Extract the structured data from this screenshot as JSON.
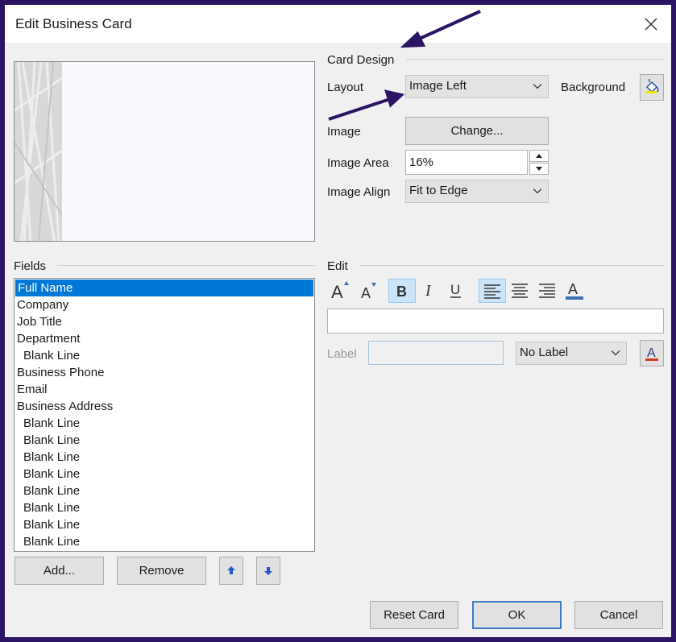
{
  "window": {
    "title": "Edit Business Card"
  },
  "card_design": {
    "heading": "Card Design",
    "layout_label": "Layout",
    "layout_value": "Image Left",
    "background_label": "Background",
    "image_label": "Image",
    "change_button": "Change...",
    "image_area_label": "Image Area",
    "image_area_value": "16%",
    "image_align_label": "Image Align",
    "image_align_value": "Fit to Edge"
  },
  "fields": {
    "heading": "Fields",
    "items": [
      {
        "label": "Full Name",
        "indent": false,
        "selected": true
      },
      {
        "label": "Company",
        "indent": false,
        "selected": false
      },
      {
        "label": "Job Title",
        "indent": false,
        "selected": false
      },
      {
        "label": "Department",
        "indent": false,
        "selected": false
      },
      {
        "label": "Blank Line",
        "indent": true,
        "selected": false
      },
      {
        "label": "Business Phone",
        "indent": false,
        "selected": false
      },
      {
        "label": "Email",
        "indent": false,
        "selected": false
      },
      {
        "label": "Business Address",
        "indent": false,
        "selected": false
      },
      {
        "label": "Blank Line",
        "indent": true,
        "selected": false
      },
      {
        "label": "Blank Line",
        "indent": true,
        "selected": false
      },
      {
        "label": "Blank Line",
        "indent": true,
        "selected": false
      },
      {
        "label": "Blank Line",
        "indent": true,
        "selected": false
      },
      {
        "label": "Blank Line",
        "indent": true,
        "selected": false
      },
      {
        "label": "Blank Line",
        "indent": true,
        "selected": false
      },
      {
        "label": "Blank Line",
        "indent": true,
        "selected": false
      },
      {
        "label": "Blank Line",
        "indent": true,
        "selected": false
      }
    ],
    "add_button": "Add...",
    "remove_button": "Remove"
  },
  "edit": {
    "heading": "Edit",
    "text_value": "",
    "label_label": "Label",
    "label_value": "",
    "label_position": "No Label",
    "bold_active": true,
    "align_left_active": true
  },
  "footer": {
    "reset_button": "Reset Card",
    "ok_button": "OK",
    "cancel_button": "Cancel"
  },
  "colors": {
    "frame": "#2b1464",
    "selection": "#0078d7",
    "annotation_arrow": "#2b1464",
    "font_color_bar": "#3c6fb5",
    "label_color_bar": "#d23c1e"
  }
}
